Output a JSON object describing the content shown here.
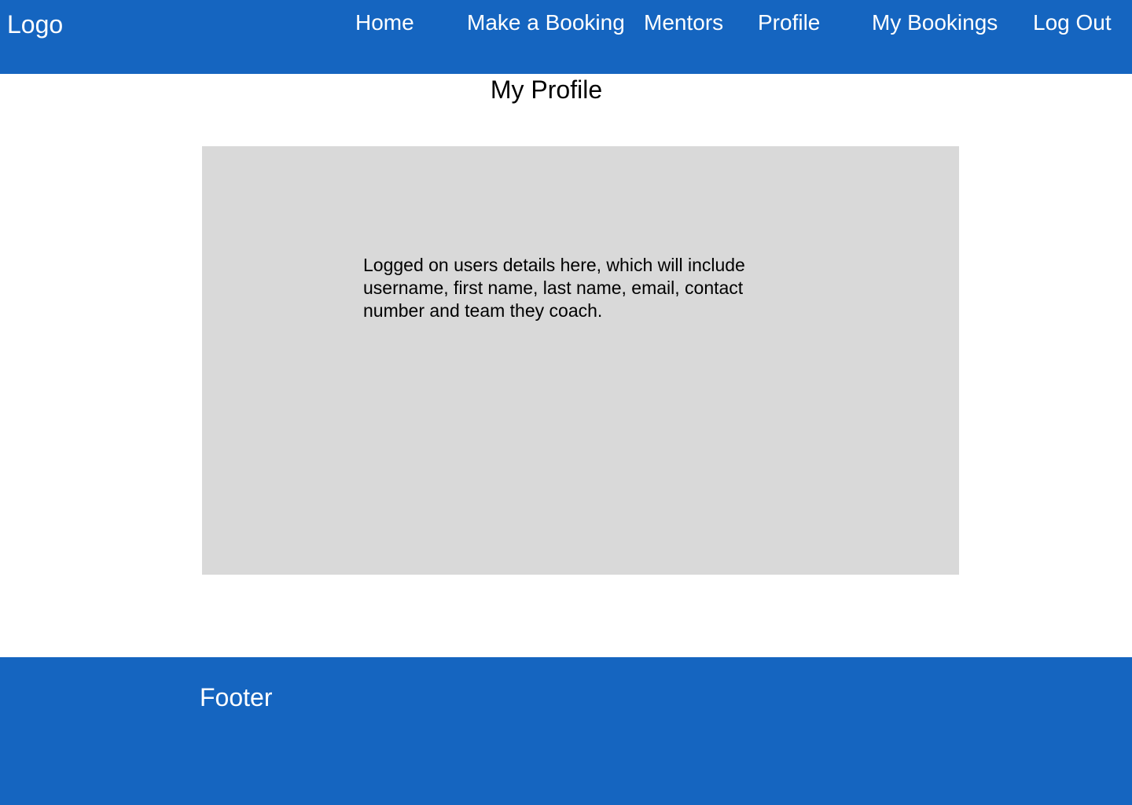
{
  "colors": {
    "header_bg": "#1565C0",
    "panel_bg": "#D9D9D9",
    "text_light": "#FFFFFF",
    "text_dark": "#000000"
  },
  "header": {
    "logo": "Logo",
    "nav": {
      "home": "Home",
      "make_booking": "Make a Booking",
      "mentors": "Mentors",
      "profile": "Profile",
      "my_bookings": "My Bookings",
      "log_out": "Log Out"
    }
  },
  "main": {
    "title": "My Profile",
    "details_text": "Logged on users details here, which will include username, first name, last name, email, contact number and team they coach."
  },
  "footer": {
    "label": "Footer"
  }
}
